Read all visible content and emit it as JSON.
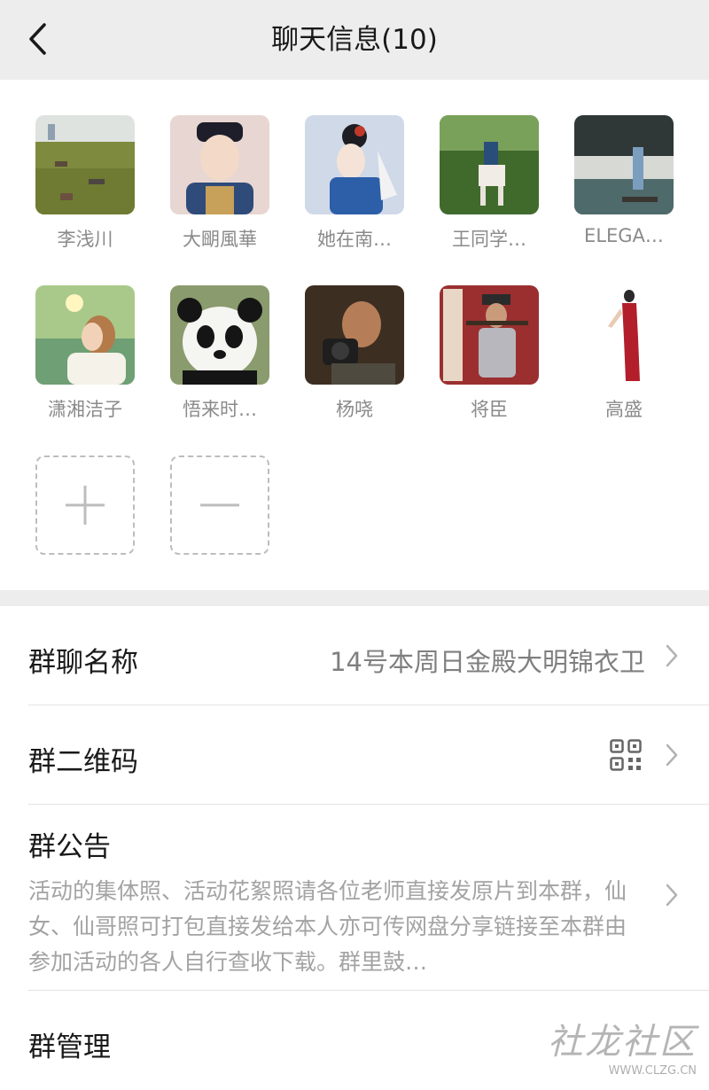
{
  "nav": {
    "title": "聊天信息(10)"
  },
  "members": [
    {
      "name": "李浅川",
      "avatar": "grass-field-people-avatar"
    },
    {
      "name": "大朙風華",
      "avatar": "anime-boy-avatar"
    },
    {
      "name": "她在南…",
      "avatar": "painted-lady-avatar"
    },
    {
      "name": "王同学…",
      "avatar": "horse-rider-avatar"
    },
    {
      "name": "ELEGA…",
      "avatar": "lake-woman-avatar"
    },
    {
      "name": "潇湘洁子",
      "avatar": "illustrated-girl-avatar"
    },
    {
      "name": "悟来时…",
      "avatar": "panda-avatar"
    },
    {
      "name": "杨哓",
      "avatar": "photographer-avatar"
    },
    {
      "name": "将臣",
      "avatar": "warrior-costume-avatar"
    },
    {
      "name": "高盛",
      "avatar": "red-dress-avatar"
    }
  ],
  "group_name": {
    "label": "群聊名称",
    "value": "14号本周日金殿大明锦衣卫"
  },
  "qr_code": {
    "label": "群二维码",
    "icon": "qr-code-icon"
  },
  "notice": {
    "label": "群公告",
    "text": "活动的集体照、活动花絮照请各位老师直接发原片到本群，仙女、仙哥照可打包直接发给本人亦可传网盘分享链接至本群由参加活动的各人自行查收下载。群里鼓…"
  },
  "manage": {
    "label": "群管理"
  },
  "watermark": {
    "main": "社龙社区",
    "url": "WWW.CLZG.CN"
  }
}
